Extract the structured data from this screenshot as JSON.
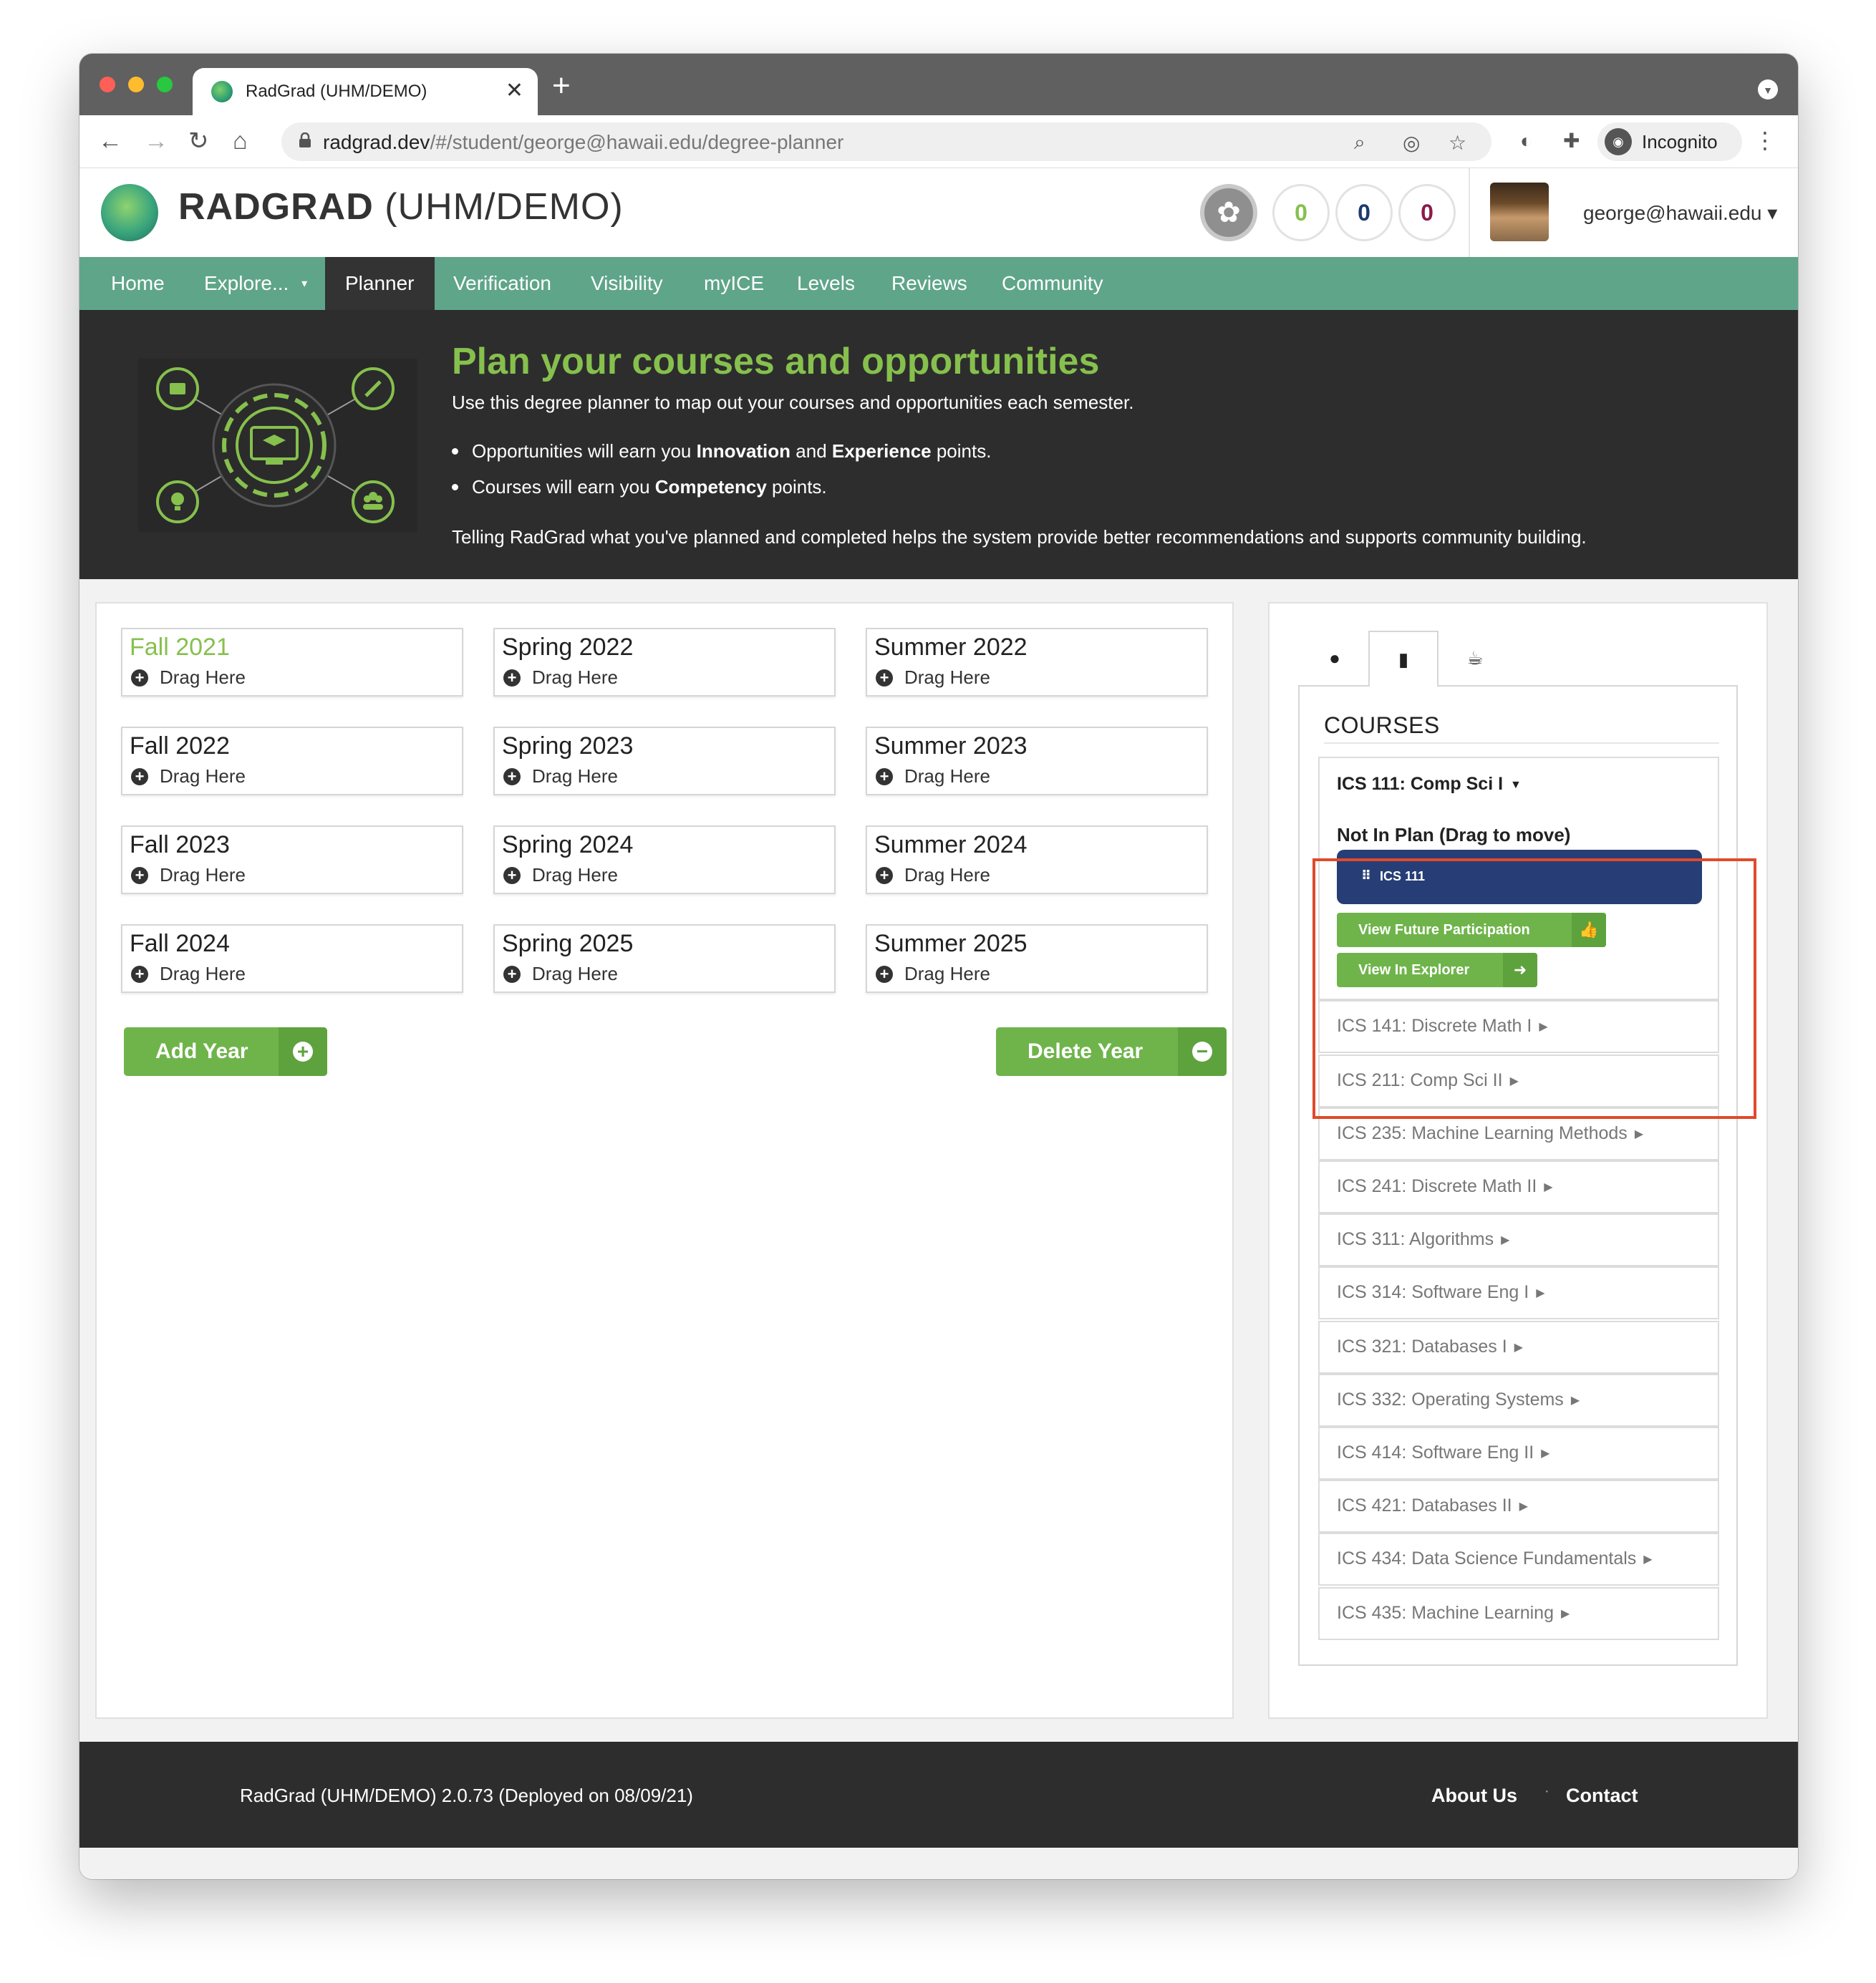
{
  "browser": {
    "tab_title": "RadGrad (UHM/DEMO)",
    "url_host": "radgrad.dev",
    "url_path": "/#/student/george@hawaii.edu/degree-planner",
    "profile_label": "Incognito",
    "traffic_light_colors": [
      "#ff5f57",
      "#febc2e",
      "#28c840"
    ]
  },
  "header": {
    "brand_bold": "RADGRAD",
    "brand_rest": " (UHM/DEMO)",
    "scores": [
      {
        "value": "0",
        "color": "#86c04d"
      },
      {
        "value": "0",
        "color": "#1f3a6e"
      },
      {
        "value": "0",
        "color": "#8b1a4a"
      }
    ],
    "user": "george@hawaii.edu ▾"
  },
  "menu": [
    "Home",
    "Explore...",
    "Planner",
    "Verification",
    "Visibility",
    "myICE",
    "Levels",
    "Reviews",
    "Community"
  ],
  "explore_caret": "▾",
  "hero": {
    "title": "Plan your courses and opportunities",
    "intro": "Use this degree planner to map out your courses and opportunities each semester.",
    "bullet1_pre": "Opportunities will earn you ",
    "bullet1_b1": "Innovation",
    "bullet1_mid": " and ",
    "bullet1_b2": "Experience",
    "bullet1_post": " points.",
    "bullet2_pre": "Courses will earn you ",
    "bullet2_b": "Competency",
    "bullet2_post": " points.",
    "outro": "Telling RadGrad what you've planned and completed helps the system provide better recommendations and supports community building."
  },
  "planner": {
    "drag_label": "Drag Here",
    "semesters": [
      "Fall 2021",
      "Spring 2022",
      "Summer 2022",
      "Fall 2022",
      "Spring 2023",
      "Summer 2023",
      "Fall 2023",
      "Spring 2024",
      "Summer 2024",
      "Fall 2024",
      "Spring 2025",
      "Summer 2025"
    ],
    "add_year": "Add Year",
    "delete_year": "Delete Year"
  },
  "courses": {
    "heading": "COURSES",
    "open_course": "ICS 111: Comp Sci I",
    "not_in_plan": "Not In Plan (Drag to move)",
    "chip": "ICS 111",
    "view_future": "View Future Participation",
    "view_explorer": "View In Explorer",
    "list": [
      "ICS 141: Discrete Math I",
      "ICS 211: Comp Sci II",
      "ICS 235: Machine Learning Methods",
      "ICS 241: Discrete Math II",
      "ICS 311: Algorithms",
      "ICS 314: Software Eng I",
      "ICS 321: Databases I",
      "ICS 332: Operating Systems",
      "ICS 414: Software Eng II",
      "ICS 421: Databases II",
      "ICS 434: Data Science Fundamentals",
      "ICS 435: Machine Learning"
    ]
  },
  "footer": {
    "version": "RadGrad (UHM/DEMO) 2.0.73 (Deployed on 08/09/21)",
    "about": "About Us",
    "contact": "Contact"
  }
}
